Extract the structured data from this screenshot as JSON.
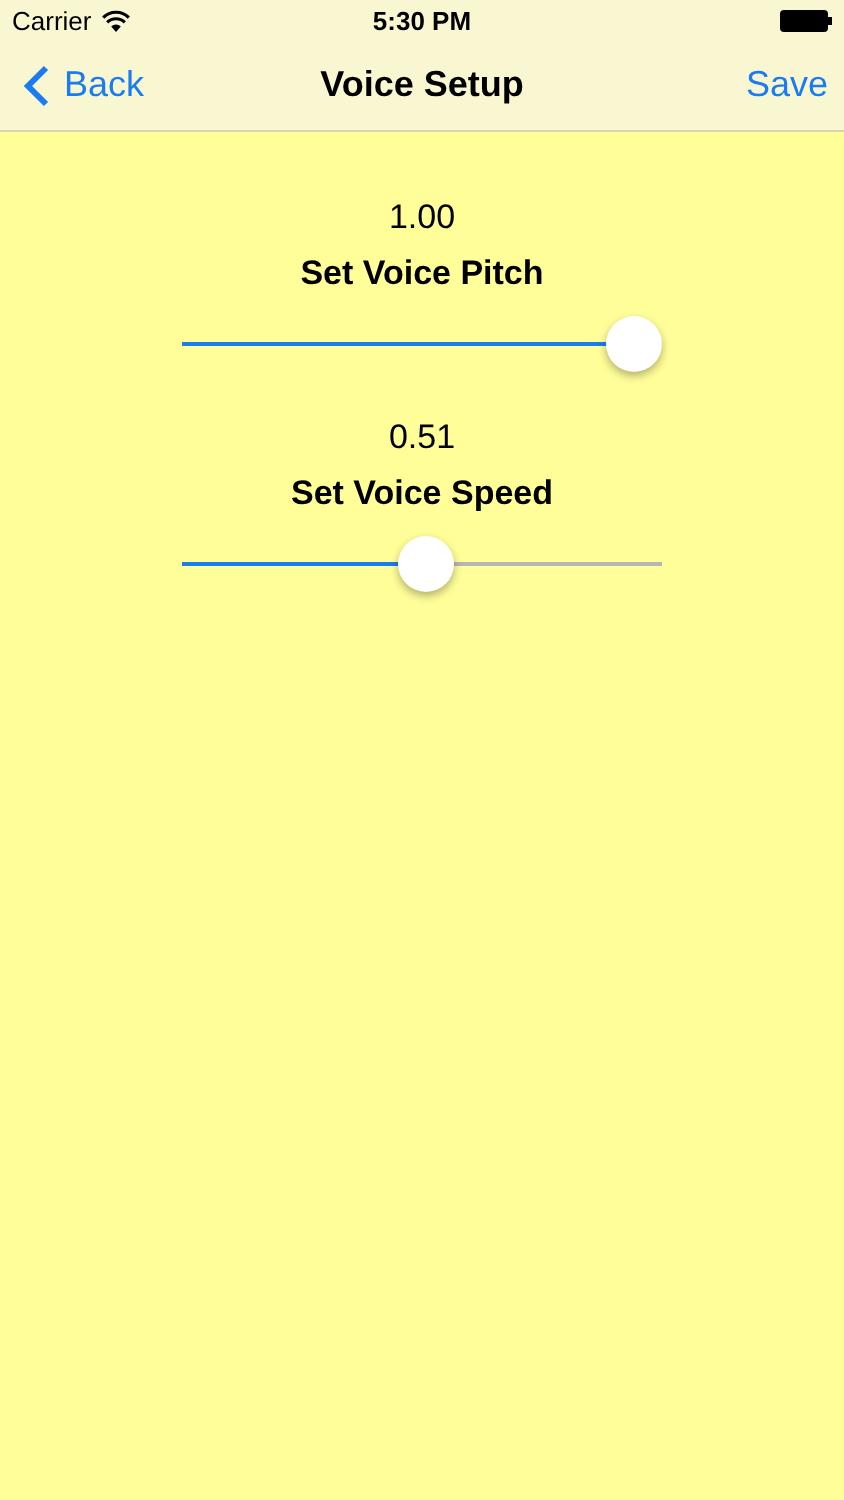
{
  "status_bar": {
    "carrier": "Carrier",
    "time": "5:30 PM"
  },
  "nav_bar": {
    "back": "Back",
    "title": "Voice Setup",
    "action": "Save"
  },
  "sliders": [
    {
      "value": "1.00",
      "label": "Set Voice Pitch",
      "level": 1
    },
    {
      "value": "0.51",
      "label": "Set Voice Speed",
      "level": 0.51
    }
  ]
}
